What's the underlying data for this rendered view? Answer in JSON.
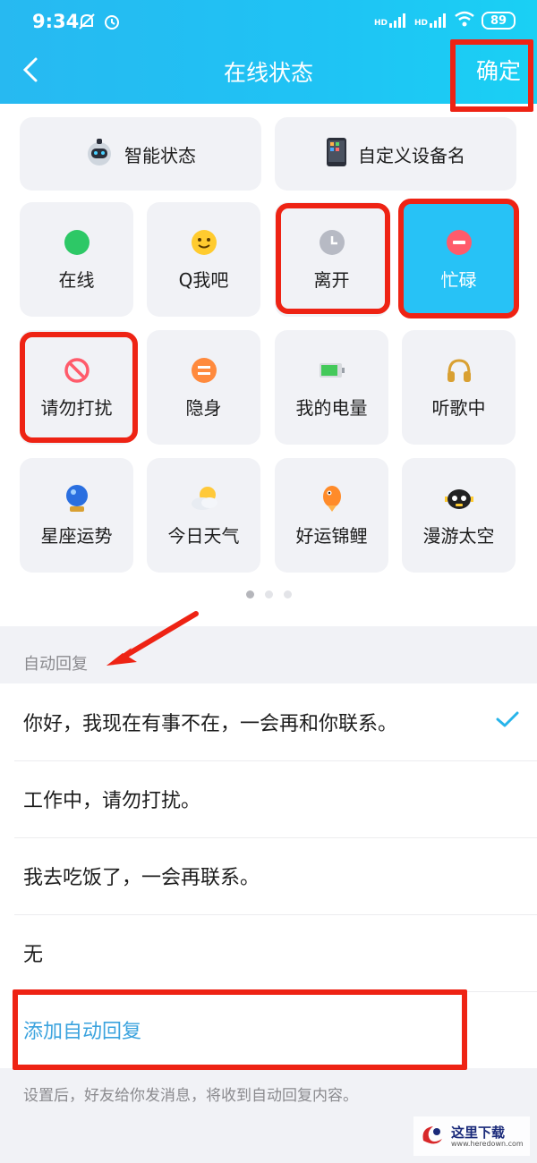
{
  "status_bar": {
    "time": "9:34",
    "signal1": "HD",
    "signal2": "HD",
    "battery": "89"
  },
  "header": {
    "title": "在线状态",
    "confirm_label": "确定"
  },
  "wide_tiles": [
    {
      "label": "智能状态",
      "icon": "robot-icon"
    },
    {
      "label": "自定义设备名",
      "icon": "phone-icon"
    }
  ],
  "status_tiles": [
    {
      "label": "在线",
      "icon": "online-dot-icon",
      "color": "#2dc866"
    },
    {
      "label": "Q我吧",
      "icon": "smile-icon",
      "color": "#ffcb2f"
    },
    {
      "label": "离开",
      "icon": "clock-icon",
      "color": "#b7bac4"
    },
    {
      "label": "忙碌",
      "icon": "minus-circle-icon",
      "color": "#ff5b6b",
      "active": true
    },
    {
      "label": "请勿打扰",
      "icon": "no-entry-icon",
      "color": "#ff5b6b"
    },
    {
      "label": "隐身",
      "icon": "equals-circle-icon",
      "color": "#ff8a3d"
    },
    {
      "label": "我的电量",
      "icon": "battery-icon",
      "color": "#44c95a"
    },
    {
      "label": "听歌中",
      "icon": "headphones-icon",
      "color": "#d9a032"
    },
    {
      "label": "星座运势",
      "icon": "crystal-ball-icon",
      "color": "#2a6fe0"
    },
    {
      "label": "今日天气",
      "icon": "weather-icon",
      "color": "#ffc93a"
    },
    {
      "label": "好运锦鲤",
      "icon": "koi-icon",
      "color": "#ff8b2a"
    },
    {
      "label": "漫游太空",
      "icon": "astronaut-icon",
      "color": "#222222"
    }
  ],
  "auto_reply": {
    "section_label": "自动回复",
    "options": [
      {
        "text": "你好，我现在有事不在，一会再和你联系。",
        "selected": true
      },
      {
        "text": "工作中，请勿打扰。",
        "selected": false
      },
      {
        "text": "我去吃饭了，一会再联系。",
        "selected": false
      },
      {
        "text": "无",
        "selected": false
      }
    ],
    "add_label": "添加自动回复",
    "note": "设置后，好友给你发消息，将收到自动回复内容。"
  },
  "watermark": {
    "text": "这里下载",
    "sub": "www.heredown.com"
  },
  "colors": {
    "accent": "#27c2f6",
    "link": "#3ba3de",
    "annotation": "#ee2314"
  }
}
